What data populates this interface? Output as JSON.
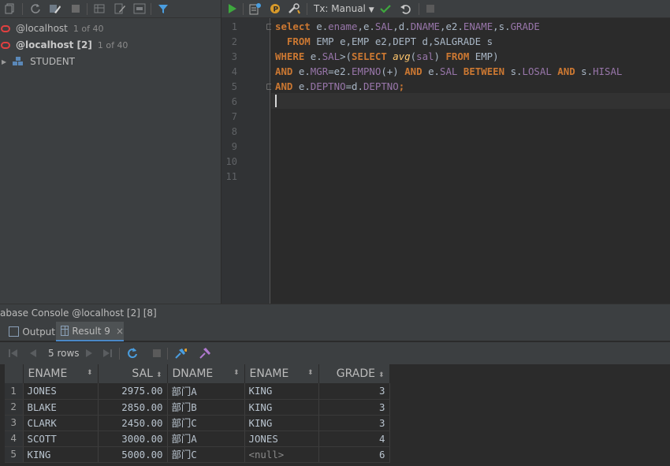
{
  "db_tree": {
    "connections": [
      {
        "name": "@localhost",
        "count": "1 of 40",
        "bold": false
      },
      {
        "name": "@localhost [2]",
        "count": "1 of 40",
        "bold": true
      }
    ],
    "schema": {
      "name": "STUDENT"
    }
  },
  "editor_toolbar": {
    "transaction_mode": "Tx: Manual"
  },
  "editor": {
    "line_numbers": [
      "1",
      "2",
      "3",
      "4",
      "5",
      "6",
      "7",
      "8",
      "9",
      "10",
      "11"
    ],
    "sql_tokens": {
      "l1": [
        "select",
        "e",
        ".",
        "ename",
        ",",
        "e",
        ".",
        "SAL",
        ",",
        "d",
        ".",
        "DNAME",
        ",",
        "e2",
        ".",
        "ENAME",
        ",",
        "s",
        ".",
        "GRADE"
      ],
      "l2": [
        "FROM",
        "EMP e,EMP e2,DEPT d,SALGRADE s"
      ],
      "l3": [
        "WHERE",
        "e",
        ".",
        "SAL",
        ">(",
        "SELECT",
        "avg",
        "(",
        "sal",
        ")",
        "FROM",
        "EMP)"
      ],
      "l4": [
        "AND",
        "e",
        ".",
        "MGR",
        "=",
        "e2",
        ".",
        "EMPNO",
        "(+)",
        "AND",
        "e",
        ".",
        "SAL",
        "BETWEEN",
        "s",
        ".",
        "LOSAL",
        "AND",
        "s",
        ".",
        "HISAL"
      ],
      "l5": [
        "AND",
        "e",
        ".",
        "DEPTNO",
        "=",
        "d",
        ".",
        "DEPTNO",
        ";"
      ]
    }
  },
  "console": {
    "title": "abase Console @localhost [2] [8]",
    "tabs": [
      {
        "label": "Output",
        "active": false
      },
      {
        "label": "Result 9",
        "active": true,
        "close": "×"
      }
    ],
    "rows_label": "5 rows"
  },
  "result_grid": {
    "columns": [
      {
        "label": "ENAME",
        "sort": "⬍"
      },
      {
        "label": "SAL",
        "sort": "⬍"
      },
      {
        "label": "DNAME",
        "sort": "⬍"
      },
      {
        "label": "ENAME",
        "sort": "⬍"
      },
      {
        "label": "GRADE",
        "sort": "⬍"
      }
    ],
    "rows": [
      {
        "n": "1",
        "ename": "JONES",
        "sal": "2975.00",
        "dname": "部门A",
        "ename2": "KING",
        "grade": "3"
      },
      {
        "n": "2",
        "ename": "BLAKE",
        "sal": "2850.00",
        "dname": "部门B",
        "ename2": "KING",
        "grade": "3"
      },
      {
        "n": "3",
        "ename": "CLARK",
        "sal": "2450.00",
        "dname": "部门C",
        "ename2": "KING",
        "grade": "3"
      },
      {
        "n": "4",
        "ename": "SCOTT",
        "sal": "3000.00",
        "dname": "部门A",
        "ename2": "JONES",
        "grade": "4"
      },
      {
        "n": "5",
        "ename": "KING",
        "sal": "5000.00",
        "dname": "部门C",
        "ename2": "<null>",
        "grade": "6"
      }
    ]
  },
  "colors": {
    "keyword": "#cc7832",
    "identifier": "#9876aa",
    "function": "#ffc66d",
    "run_green": "#3ea83e",
    "oracle_red": "#e04040",
    "tab_accent": "#4a88c7"
  },
  "icons": {
    "left_toolbar": [
      "copy-icon",
      "refresh-icon",
      "edit-properties-icon",
      "stop-icon",
      "table-icon",
      "edit-icon",
      "sql-console-icon",
      "filter-icon"
    ],
    "editor_toolbar": [
      "run-icon",
      "explain-plan-icon",
      "p-icon",
      "settings-icon",
      "dropdown-icon",
      "commit-icon",
      "rollback-icon",
      "stop-icon"
    ],
    "result_toolbar": [
      "first-page-icon",
      "prev-page-icon",
      "next-page-icon",
      "last-page-icon",
      "reload-icon",
      "stop-icon",
      "pin-icon",
      "compare-icon"
    ]
  }
}
